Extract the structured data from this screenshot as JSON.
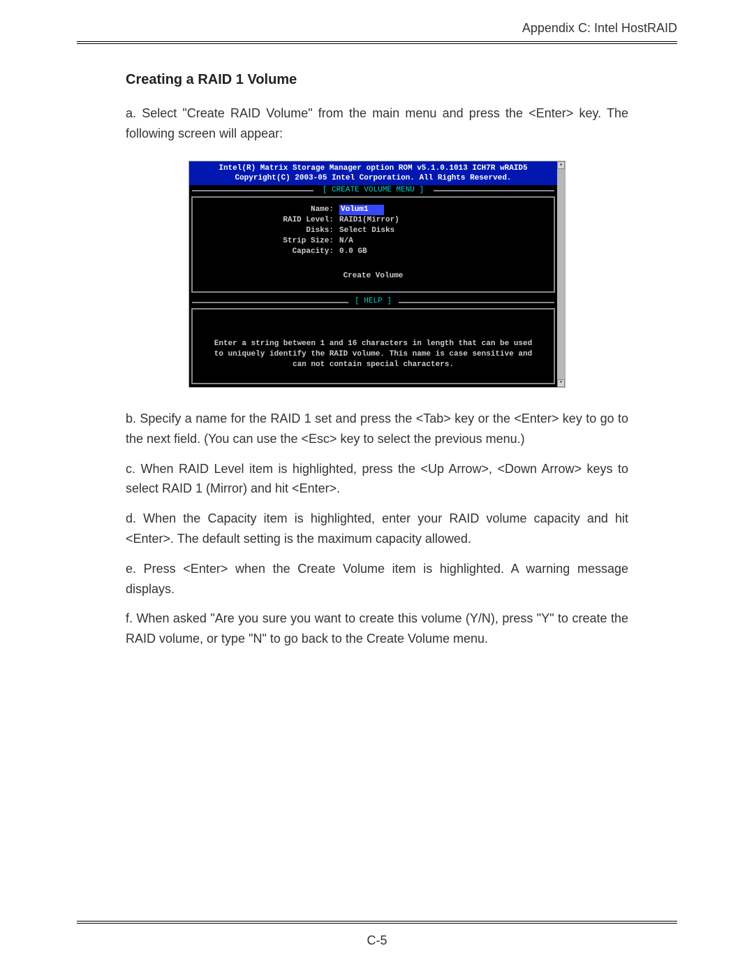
{
  "header": {
    "running_head": "Appendix C: Intel HostRAID"
  },
  "section": {
    "title": "Creating a RAID 1 Volume"
  },
  "paragraphs": {
    "a": "a. Select \"Create RAID Volume\" from the main menu and press the <Enter> key. The following screen will appear:",
    "b": "b. Specify a name for the RAID 1 set and press the <Tab> key or the <Enter> key to go to the next field. (You can use the <Esc> key to select the previous menu.)",
    "c": "c. When RAID Level item is highlighted, press the <Up Arrow>, <Down Arrow> keys to select RAID 1 (Mirror) and hit <Enter>.",
    "d": "d. When the Capacity item is highlighted, enter your RAID volume capacity and hit <Enter>.  The default setting is the maximum capacity allowed.",
    "e": "e. Press <Enter> when the Create Volume item is highlighted. A warning message displays.",
    "f": "f. When asked \"Are you sure you want to create this volume (Y/N), press \"Y\" to create the RAID volume, or type \"N\" to go back to the Create Volume menu."
  },
  "bios": {
    "title_line1": "Intel(R) Matrix Storage Manager option ROM v5.1.0.1013 ICH7R wRAID5",
    "title_line2": "Copyright(C) 2003-05 Intel Corporation.  All Rights Reserved.",
    "menu_label": "[ CREATE VOLUME MENU ]",
    "fields": {
      "name_label": "Name:",
      "name_value": "Volum1",
      "raid_level_label": "RAID Level:",
      "raid_level_value": "RAID1(Mirror)",
      "disks_label": "Disks:",
      "disks_value": "Select Disks",
      "strip_size_label": "Strip Size:",
      "strip_size_value": "N/A",
      "capacity_label": "Capacity:",
      "capacity_value": "0.0   GB"
    },
    "create_button": "Create Volume",
    "help_label": "[ HELP ]",
    "help_text_l1": "Enter a string between 1 and 16 characters in length that can be used",
    "help_text_l2": "to uniquely identify the RAID volume. This name is case sensitive and",
    "help_text_l3": "can not contain special characters."
  },
  "footer": {
    "page_number": "C-5"
  }
}
